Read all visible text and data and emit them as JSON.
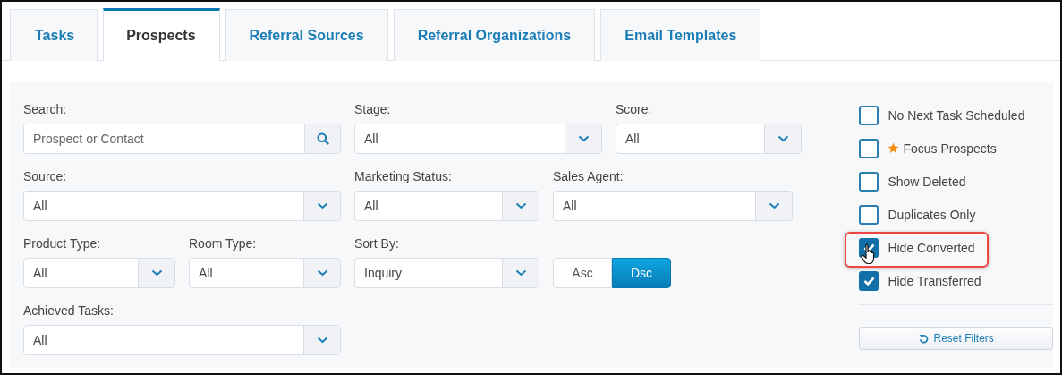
{
  "tabs": [
    {
      "label": "Tasks",
      "selected": false
    },
    {
      "label": "Prospects",
      "selected": true
    },
    {
      "label": "Referral Sources",
      "selected": false
    },
    {
      "label": "Referral Organizations",
      "selected": false
    },
    {
      "label": "Email Templates",
      "selected": false
    }
  ],
  "filter_rows": [
    [
      {
        "kind": "search",
        "label": "Search:",
        "placeholder": "Prospect or Contact"
      },
      {
        "kind": "select",
        "label": "Stage:",
        "value": "All"
      },
      {
        "kind": "select",
        "label": "Score:",
        "value": "All"
      }
    ],
    [
      {
        "kind": "select",
        "label": "Source:",
        "value": "All"
      },
      {
        "kind": "select",
        "label": "Marketing Status:",
        "value": "All"
      },
      {
        "kind": "select",
        "label": "Sales Agent:",
        "value": "All"
      }
    ],
    [
      {
        "kind": "select",
        "label": "Product Type:",
        "value": "All"
      },
      {
        "kind": "select",
        "label": "Room Type:",
        "value": "All"
      },
      {
        "kind": "select",
        "label": "Sort By:",
        "value": "Inquiry"
      },
      {
        "kind": "toggle",
        "options": [
          {
            "label": "Asc",
            "selected": false
          },
          {
            "label": "Dsc",
            "selected": true
          }
        ]
      }
    ],
    [
      {
        "kind": "select",
        "label": "Achieved Tasks:",
        "value": "All"
      }
    ]
  ],
  "options": [
    {
      "kind": "plain",
      "label": "No Next Task Scheduled",
      "checked": false,
      "highlighted": false
    },
    {
      "kind": "starred",
      "label": "Focus Prospects",
      "checked": false,
      "highlighted": false
    },
    {
      "kind": "plain",
      "label": "Show Deleted",
      "checked": false,
      "highlighted": false
    },
    {
      "kind": "plain",
      "label": "Duplicates Only",
      "checked": false,
      "highlighted": false
    },
    {
      "kind": "plain",
      "label": "Hide Converted",
      "checked": true,
      "highlighted": true
    },
    {
      "kind": "plain",
      "label": "Hide Transferred",
      "checked": true,
      "highlighted": false
    }
  ],
  "reset_button": {
    "label": "Reset Filters"
  }
}
